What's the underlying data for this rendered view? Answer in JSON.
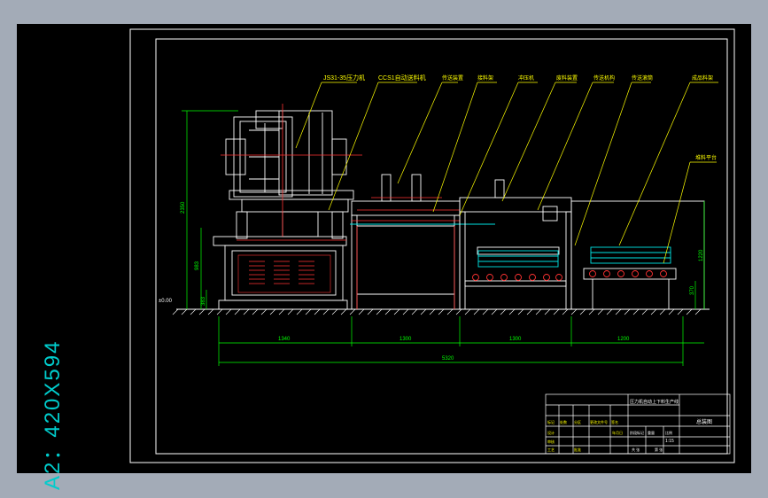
{
  "sheet": {
    "size_label": "A2：420X594"
  },
  "callouts": [
    "JS31-35压力机",
    "CCS1自动送料机",
    "传送装置",
    "接料架",
    "冲压机",
    "废料装置",
    "传送机构",
    "传送滚筒",
    "成品料架",
    "堆料平台"
  ],
  "dimensions": {
    "left_height": "2350",
    "left_height2": "983",
    "left_small": "383",
    "zero_level": "±0.00",
    "right_height": "1220",
    "right_small": "370",
    "segments": [
      "1340",
      "1300",
      "1300",
      "1200"
    ],
    "total": "5320"
  },
  "title_block": {
    "drawing_title": "压力机自动上下料生产线",
    "drawing_name": "总装图",
    "scale": "1:15",
    "rows": [
      "标记",
      "处数",
      "分区",
      "更改文件号",
      "签名",
      "年月日"
    ],
    "roles": [
      "设计",
      "审核",
      "工艺",
      "批准"
    ],
    "fields": [
      "阶段标记",
      "重量",
      "比例"
    ],
    "sheet_info": [
      "共 张",
      "第 张"
    ]
  },
  "colors": {
    "background": "#000000",
    "frame": "#ffffff",
    "leader": "#ffff00",
    "dimension": "#00ff00",
    "machine": "#ffffff",
    "conveyor": "#00e5e5",
    "roller": "#ff3333",
    "sheet_label": "#00cccc"
  }
}
